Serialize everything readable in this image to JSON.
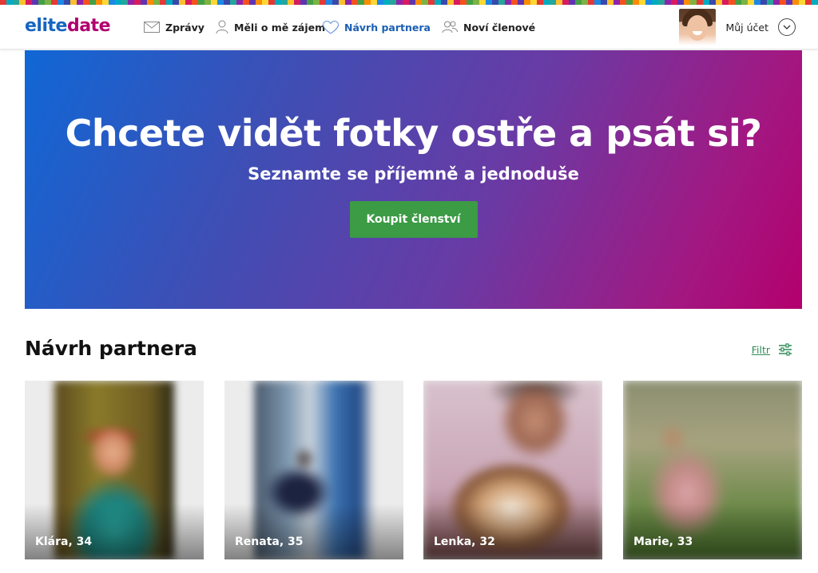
{
  "brand": {
    "part1": "elite",
    "part2": "date"
  },
  "colors": {
    "brand_blue": "#1565c0",
    "brand_magenta": "#b0006e",
    "cta_green": "#3c9b45",
    "filter_green": "#2e8b57",
    "nav_active": "#1a5fb4"
  },
  "nav": {
    "items": [
      {
        "label": "Zprávy",
        "icon": "envelope-icon"
      },
      {
        "label": "Měli o mě zájem",
        "icon": "person-icon"
      },
      {
        "label": "Návrh partnera",
        "icon": "heart-icon"
      },
      {
        "label": "Noví členové",
        "icon": "people-icon"
      }
    ],
    "account_label": "Můj účet"
  },
  "hero": {
    "title": "Chcete vidět fotky ostře a psát si?",
    "subtitle": "Seznamte se příjemně a jednoduše",
    "button": "Koupit členství"
  },
  "section": {
    "title": "Návrh partnera",
    "filter_label": "Filtr"
  },
  "profiles": [
    {
      "name": "Klára, 34"
    },
    {
      "name": "Renata, 35"
    },
    {
      "name": "Lenka, 32"
    },
    {
      "name": "Marie, 33"
    }
  ]
}
